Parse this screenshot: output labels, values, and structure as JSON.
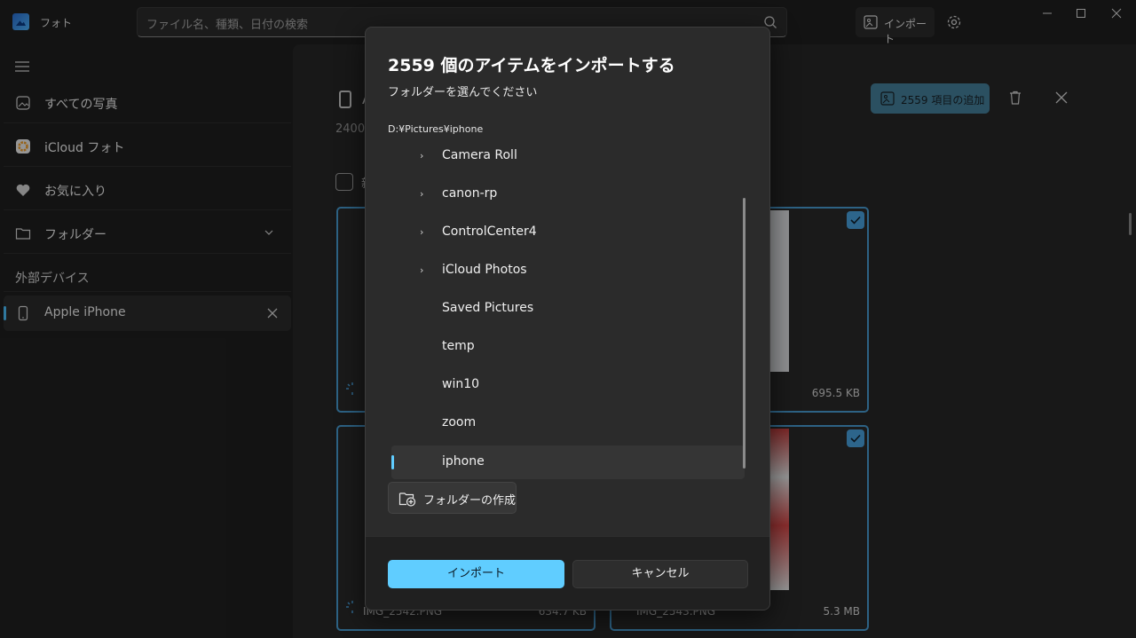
{
  "app": {
    "title": "フォト"
  },
  "search": {
    "placeholder": "ファイル名、種類、日付の検索"
  },
  "toolbar": {
    "import_label": "インポート"
  },
  "sidebar": {
    "items": [
      {
        "label": "すべての写真",
        "icon": "photos-icon"
      },
      {
        "label": "iCloud フォト",
        "icon": "icloud-photos-icon"
      },
      {
        "label": "お気に入り",
        "icon": "heart-icon"
      },
      {
        "label": "フォルダー",
        "icon": "folder-icon"
      }
    ],
    "section_label": "外部デバイス",
    "device": {
      "label": "Apple iPhone",
      "icon": "phone-icon"
    }
  },
  "main": {
    "count_text": "2400",
    "title_partial": "A",
    "select_label_partial": "新",
    "add_button_label": "2559 項目の追加",
    "tiles": [
      {
        "size": "695.5 KB"
      },
      {
        "filename": "IMG_2542.PNG",
        "size": "634.7 KB"
      },
      {
        "filename": "IMG_2543.PNG",
        "size": "5.3 MB"
      }
    ]
  },
  "dialog": {
    "title": "2559 個のアイテムをインポートする",
    "subtitle": "フォルダーを選んでください",
    "path": "D:¥Pictures¥iphone",
    "folders": [
      {
        "label": "Camera Roll",
        "expandable": true
      },
      {
        "label": "canon-rp",
        "expandable": true
      },
      {
        "label": "ControlCenter4",
        "expandable": true
      },
      {
        "label": "iCloud Photos",
        "expandable": true
      },
      {
        "label": "Saved Pictures",
        "expandable": false
      },
      {
        "label": "temp",
        "expandable": false
      },
      {
        "label": "win10",
        "expandable": false
      },
      {
        "label": "zoom",
        "expandable": false
      },
      {
        "label": "iphone",
        "expandable": false,
        "selected": true
      }
    ],
    "new_folder_label": "フォルダーの作成",
    "import_label": "インポート",
    "cancel_label": "キャンセル"
  },
  "colors": {
    "accent": "#60cdff",
    "background": "#202020",
    "dialog": "#2b2b2b"
  }
}
